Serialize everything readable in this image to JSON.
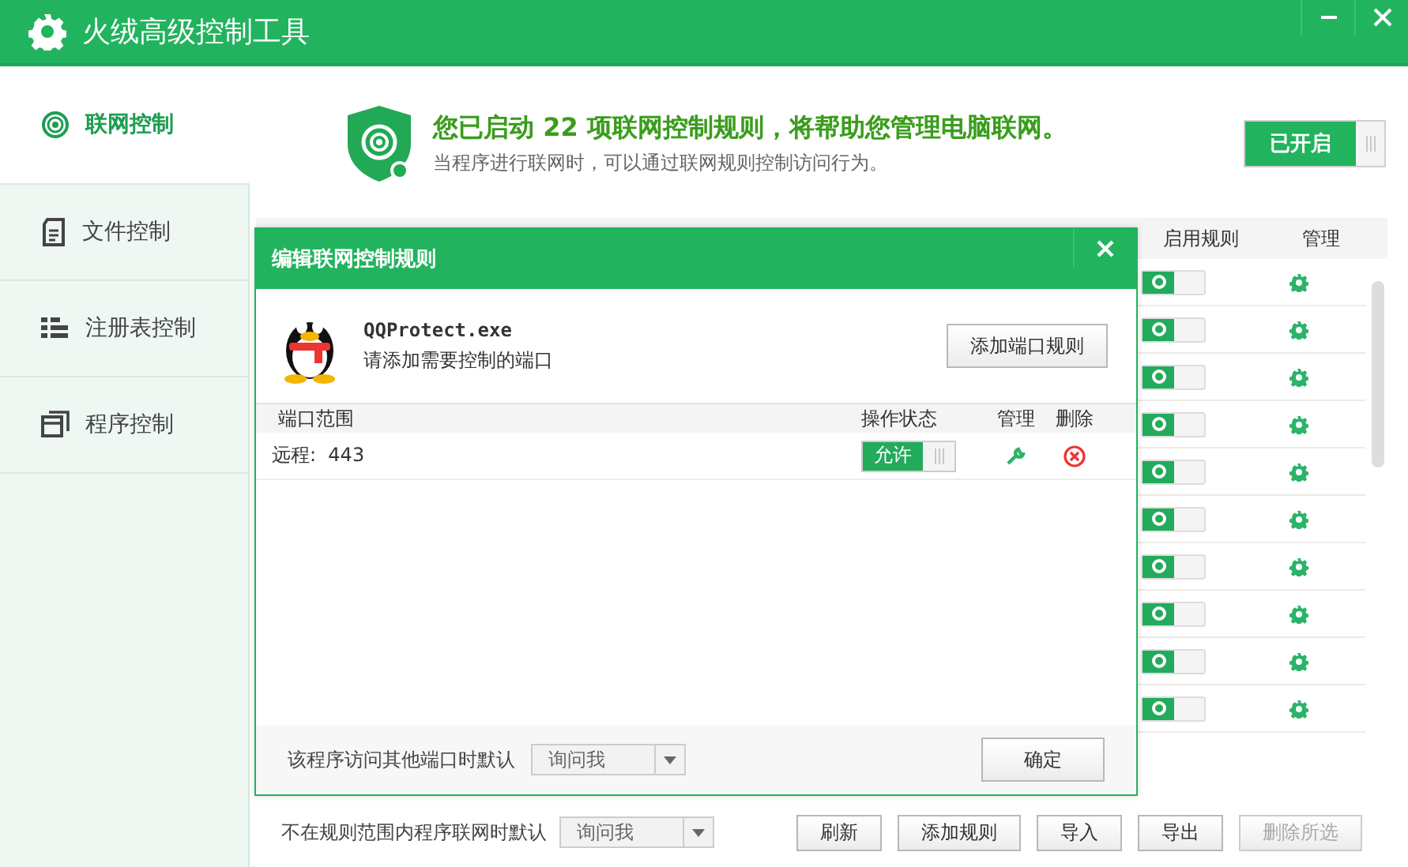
{
  "window": {
    "title": "火绒高级控制工具"
  },
  "sidebar": {
    "items": [
      {
        "label": "联网控制",
        "selected": true
      },
      {
        "label": "文件控制",
        "selected": false
      },
      {
        "label": "注册表控制",
        "selected": false
      },
      {
        "label": "程序控制",
        "selected": false
      }
    ]
  },
  "banner": {
    "headline": "您已启动 22 项联网控制规则，将帮助您管理电脑联网。",
    "subtitle": "当程序进行联网时，可以通过联网规则控制访问行为。",
    "switch": {
      "label": "已开启",
      "on": true
    }
  },
  "rules_table": {
    "columns": [
      "启用规则",
      "管理"
    ],
    "rows": [
      {
        "enabled": true
      },
      {
        "enabled": true
      },
      {
        "enabled": true
      },
      {
        "enabled": true
      },
      {
        "enabled": true
      },
      {
        "enabled": true
      },
      {
        "enabled": true
      },
      {
        "enabled": true
      },
      {
        "enabled": true
      },
      {
        "enabled": true
      }
    ]
  },
  "bottom_bar": {
    "default_label": "不在规则范围内程序联网时默认",
    "default_value": "询问我",
    "buttons": [
      {
        "label": "刷新",
        "disabled": false
      },
      {
        "label": "添加规则",
        "disabled": false
      },
      {
        "label": "导入",
        "disabled": false
      },
      {
        "label": "导出",
        "disabled": false
      },
      {
        "label": "删除所选",
        "disabled": true
      }
    ]
  },
  "dialog": {
    "title": "编辑联网控制规则",
    "program": "QQProtect.exe",
    "hint": "请添加需要控制的端口",
    "add_button": "添加端口规则",
    "columns": [
      "端口范围",
      "操作状态",
      "管理",
      "删除"
    ],
    "rows": [
      {
        "port": "远程:  443",
        "action": "允许",
        "allowed": true
      }
    ],
    "default_label": "该程序访问其他端口时默认",
    "default_value": "询问我",
    "ok_button": "确定"
  }
}
